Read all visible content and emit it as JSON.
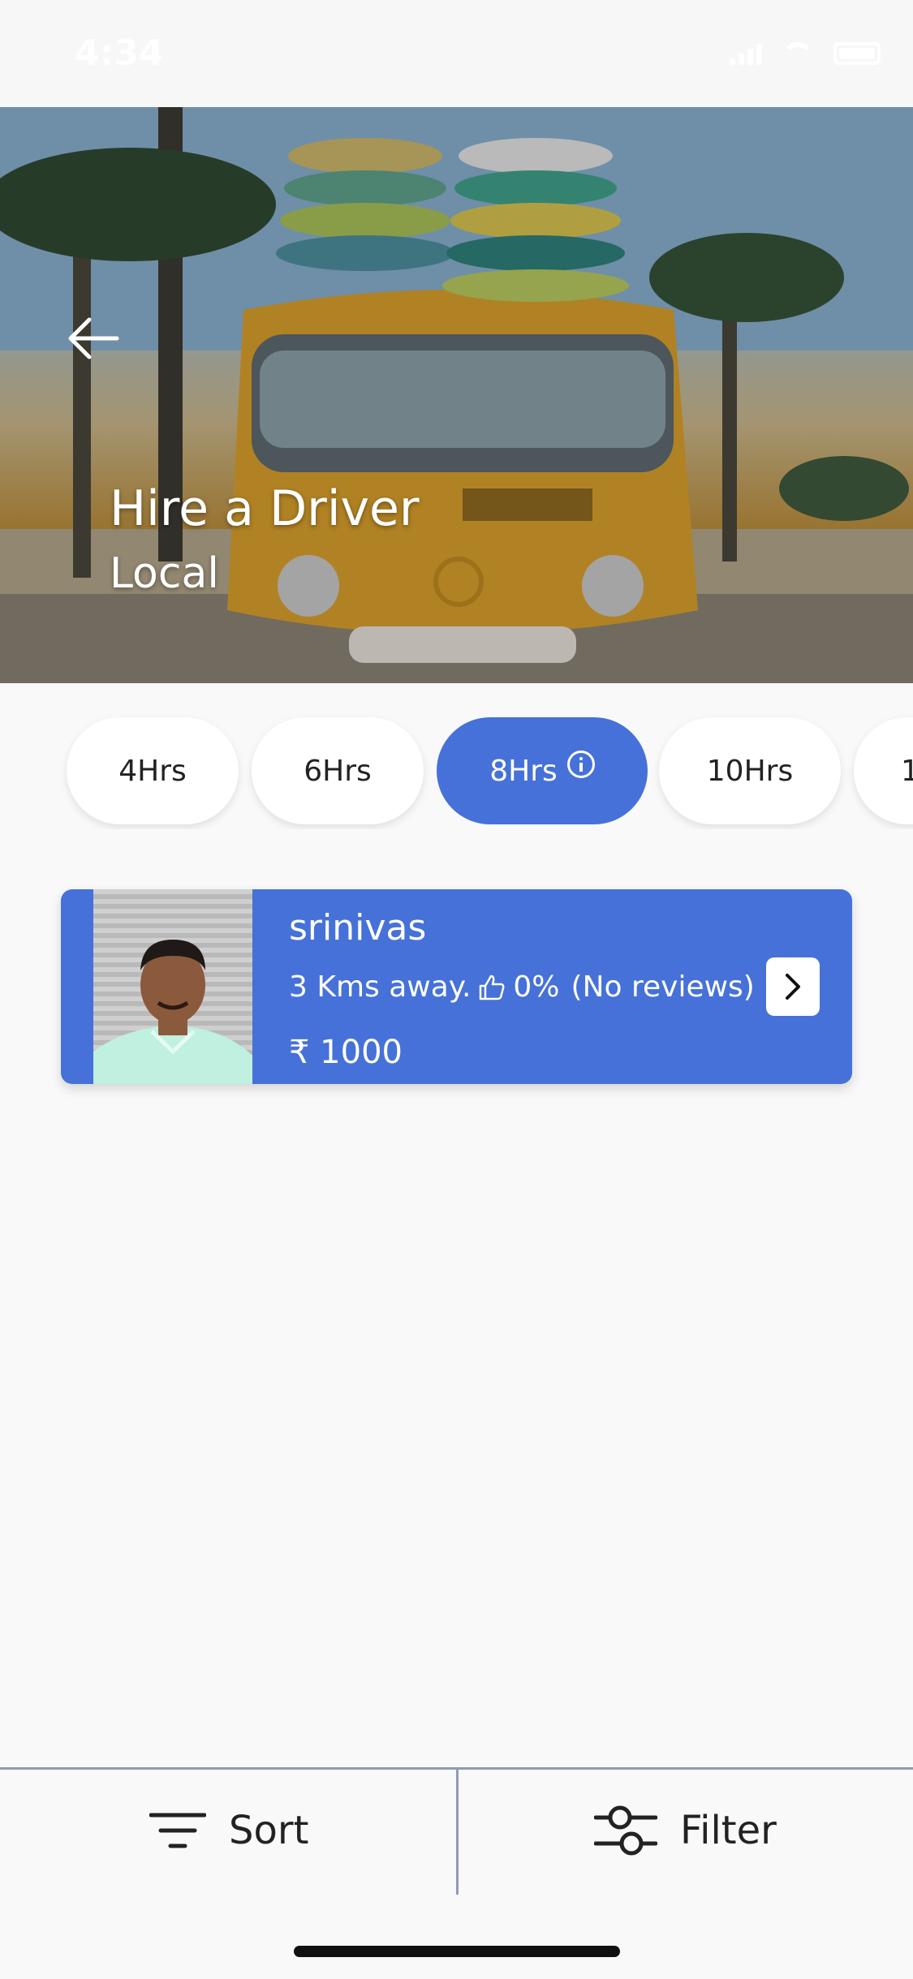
{
  "status_bar": {
    "time": "4:34",
    "icons": [
      "signal-icon",
      "wifi-icon",
      "battery-icon"
    ]
  },
  "header": {
    "title": "Hire a Driver",
    "subtitle": "Local",
    "back_icon": "arrow-left-icon"
  },
  "duration_tabs": {
    "items": [
      {
        "label": "4Hrs"
      },
      {
        "label": "6Hrs"
      },
      {
        "label": "8Hrs",
        "active": true,
        "info_icon": "info-icon"
      },
      {
        "label": "10Hrs"
      },
      {
        "label": "1"
      }
    ]
  },
  "driver_card": {
    "name": "srinivas",
    "distance": "3 Kms away.",
    "rating": "0%",
    "reviews": "(No reviews)",
    "price": "₹ 1000",
    "next_icon": "chevron-right-icon"
  },
  "bottom_bar": {
    "sort_label": "Sort",
    "filter_label": "Filter"
  },
  "colors": {
    "accent": "#4671d8",
    "divider": "#8d9db3",
    "background": "#f9f9f9"
  }
}
